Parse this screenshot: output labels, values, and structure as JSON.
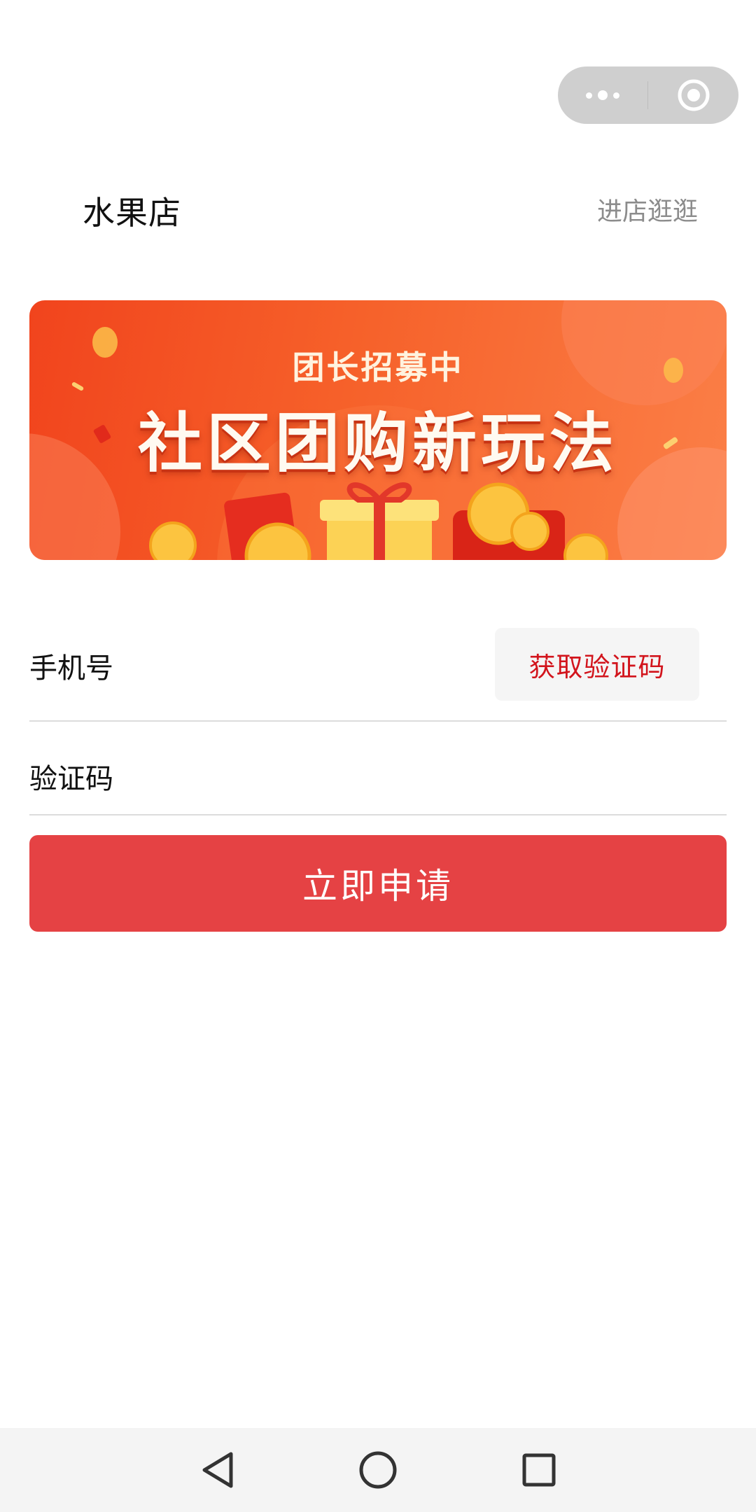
{
  "header": {
    "shop_name": "水果店",
    "visit_shop_label": "进店逛逛"
  },
  "capsule": {
    "more_icon": "more-dots-icon",
    "close_icon": "target-close-icon"
  },
  "banner": {
    "subtitle": "团长招募中",
    "title": "社区团购新玩法",
    "colors": {
      "start": "#f1441d",
      "end": "#fb7f47"
    }
  },
  "form": {
    "phone_label": "手机号",
    "code_label": "验证码",
    "get_code_button": "获取验证码",
    "submit_button": "立即申请"
  },
  "nav": {
    "back_icon": "triangle-back-icon",
    "home_icon": "circle-home-icon",
    "recent_icon": "square-recents-icon"
  },
  "colors": {
    "accent_red": "#e54244",
    "code_text_red": "#d2141c"
  }
}
